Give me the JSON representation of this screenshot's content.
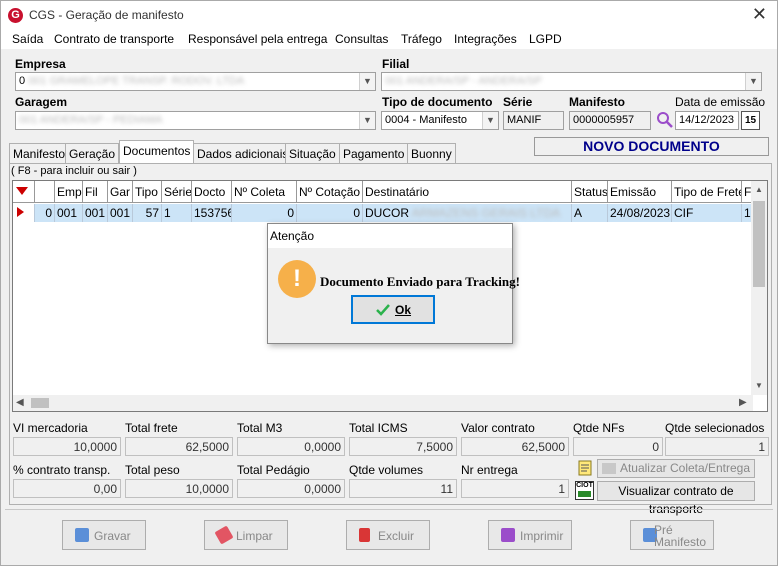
{
  "window": {
    "title": "CGS - Geração de manifesto",
    "close_glyph": "✕"
  },
  "menu": [
    "Saída",
    "Contrato de transporte",
    "Responsável pela entrega",
    "Consultas",
    "Tráfego",
    "Integrações",
    "LGPD"
  ],
  "form": {
    "empresa_label": "Empresa",
    "empresa_value": "0",
    "empresa_obscured": "001 GRAMELOPE TRANSP. RODOV. LTDA",
    "filial_label": "Filial",
    "filial_obscured": "001 ANDERA/SP - ANDERA/SP",
    "garagem_label": "Garagem",
    "garagem_obscured": "001 ANDERA/SP - PEDIAMA",
    "tipo_doc_label": "Tipo de documento",
    "tipo_doc_value": "0004 - Manifesto",
    "serie_label": "Série",
    "serie_value": "MANIF",
    "manifesto_label": "Manifesto",
    "manifesto_value": "0000005957",
    "data_emissao_label": "Data de emissão",
    "data_emissao_value": "14/12/2023",
    "calendar_day": "15",
    "status_banner": "NOVO DOCUMENTO"
  },
  "tabs": [
    "Manifesto",
    "Geração",
    "Documentos",
    "Dados adicionais",
    "Situação",
    "Pagamento",
    "Buonny"
  ],
  "active_tab": "Documentos",
  "hint": "( F8 - para incluir ou sair )",
  "grid": {
    "headers": [
      "Emp",
      "Fil",
      "Gar",
      "Tipo",
      "Série",
      "Docto",
      "Nº Coleta",
      "Nº Cotação",
      "Destinatário",
      "Status",
      "Emissão",
      "Tipo de Frete",
      "F"
    ],
    "row": {
      "sel": "0",
      "emp": "001",
      "fil": "001",
      "gar": "001",
      "tipo": "57",
      "serie": "1",
      "docto": "153756",
      "coleta": "0",
      "cotacao": "0",
      "destinatario": "DUCOR",
      "destinatario_obscured": "ARMAZENS GERAIS LTDA",
      "status": "A",
      "emissao": "24/08/2023",
      "tipo_frete": "CIF",
      "f": "1"
    }
  },
  "totals": {
    "vl_mercadoria_label": "VI mercadoria",
    "vl_mercadoria": "10,0000",
    "total_frete_label": "Total frete",
    "total_frete": "62,5000",
    "total_m3_label": "Total M3",
    "total_m3": "0,0000",
    "total_icms_label": "Total ICMS",
    "total_icms": "7,5000",
    "valor_contrato_label": "Valor contrato",
    "valor_contrato": "62,5000",
    "qtde_nfs_label": "Qtde NFs",
    "qtde_nfs": "0",
    "qtde_sel_label": "Qtde selecionados",
    "qtde_sel": "1",
    "pct_contrato_label": "% contrato transp.",
    "pct_contrato": "0,00",
    "total_peso_label": "Total peso",
    "total_peso": "10,0000",
    "total_pedagio_label": "Total Pedágio",
    "total_pedagio": "0,0000",
    "qtde_volumes_label": "Qtde volumes",
    "qtde_volumes": "11",
    "nr_entrega_label": "Nr entrega",
    "nr_entrega": "1"
  },
  "actions": {
    "atualizar": "Atualizar Coleta/Entrega",
    "visualizar": "Visualizar contrato de transporte",
    "ciot_label": "CIOT"
  },
  "bottom_buttons": {
    "gravar": "Gravar",
    "limpar": "Limpar",
    "excluir": "Excluir",
    "imprimir": "Imprimir",
    "pre_manifesto_1": "Pré",
    "pre_manifesto_2": "Manifesto"
  },
  "dialog": {
    "title": "Atenção",
    "icon_glyph": "!",
    "message": "Documento Enviado para Tracking!",
    "ok_label": "Ok"
  }
}
